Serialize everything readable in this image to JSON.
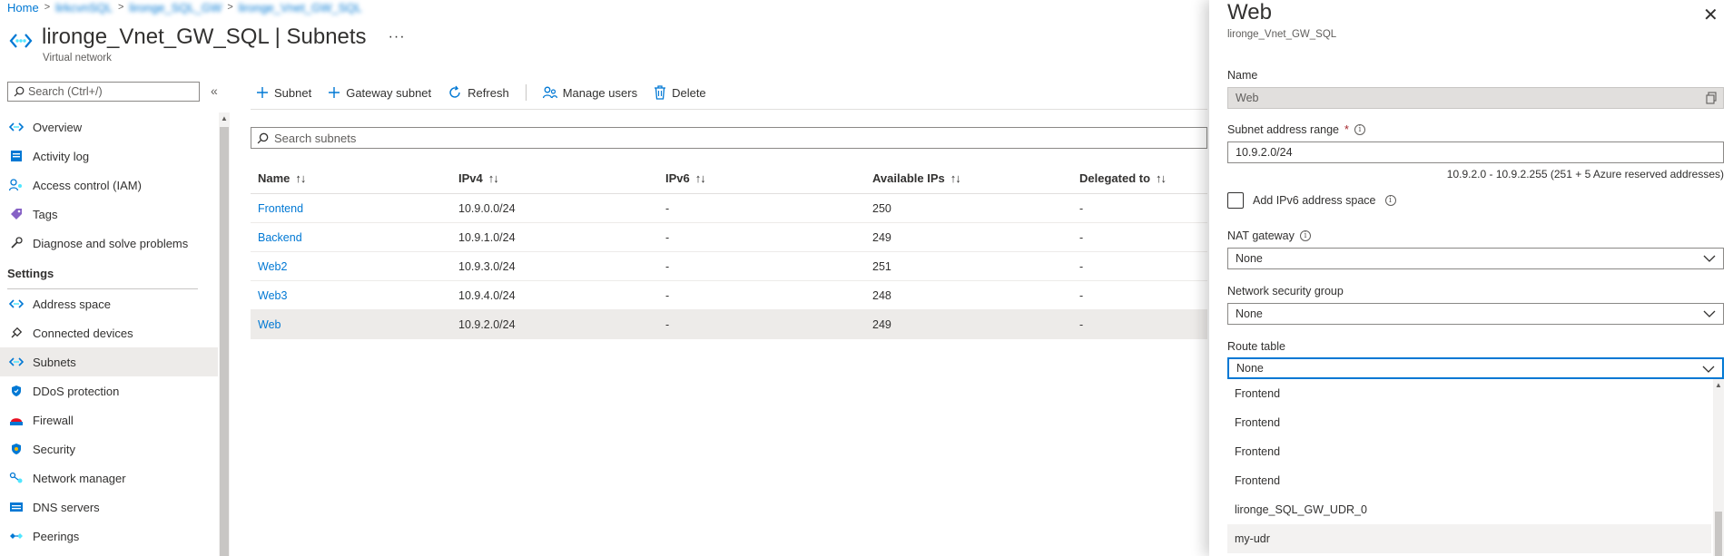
{
  "breadcrumb": {
    "home": "Home",
    "blurred1": "lirkcvnSQL",
    "blurred2": "lironge_SQL_GW",
    "blurred3": "lironge_Vnet_GW_SQL"
  },
  "header": {
    "title": "lironge_Vnet_GW_SQL | Subnets",
    "subtitle": "Virtual network",
    "more": "···"
  },
  "left_nav": {
    "search_placeholder": "Search (Ctrl+/)",
    "collapse": "«",
    "items_top": [
      {
        "label": "Overview",
        "icon": "vnet-icon"
      },
      {
        "label": "Activity log",
        "icon": "activity-log-icon"
      },
      {
        "label": "Access control (IAM)",
        "icon": "iam-icon"
      },
      {
        "label": "Tags",
        "icon": "tag-icon"
      },
      {
        "label": "Diagnose and solve problems",
        "icon": "wrench-icon"
      }
    ],
    "settings_label": "Settings",
    "items_settings": [
      {
        "label": "Address space",
        "icon": "vnet-icon"
      },
      {
        "label": "Connected devices",
        "icon": "plug-icon"
      },
      {
        "label": "Subnets",
        "icon": "vnet-icon",
        "active": true
      },
      {
        "label": "DDoS protection",
        "icon": "shield-icon"
      },
      {
        "label": "Firewall",
        "icon": "firewall-icon"
      },
      {
        "label": "Security",
        "icon": "security-icon"
      },
      {
        "label": "Network manager",
        "icon": "network-manager-icon"
      },
      {
        "label": "DNS servers",
        "icon": "dns-icon"
      },
      {
        "label": "Peerings",
        "icon": "peerings-icon"
      }
    ]
  },
  "toolbar": {
    "subnet": "Subnet",
    "gateway_subnet": "Gateway subnet",
    "refresh": "Refresh",
    "manage_users": "Manage users",
    "delete": "Delete"
  },
  "subnet_search_placeholder": "Search subnets",
  "table": {
    "columns": [
      "Name",
      "IPv4",
      "IPv6",
      "Available IPs",
      "Delegated to"
    ],
    "sort_glyph": "↑↓",
    "rows": [
      {
        "name": "Frontend",
        "ipv4": "10.9.0.0/24",
        "ipv6": "-",
        "available": "250",
        "delegated": "-"
      },
      {
        "name": "Backend",
        "ipv4": "10.9.1.0/24",
        "ipv6": "-",
        "available": "249",
        "delegated": "-"
      },
      {
        "name": "Web2",
        "ipv4": "10.9.3.0/24",
        "ipv6": "-",
        "available": "251",
        "delegated": "-"
      },
      {
        "name": "Web3",
        "ipv4": "10.9.4.0/24",
        "ipv6": "-",
        "available": "248",
        "delegated": "-"
      },
      {
        "name": "Web",
        "ipv4": "10.9.2.0/24",
        "ipv6": "-",
        "available": "249",
        "delegated": "-"
      }
    ]
  },
  "panel": {
    "title": "Web",
    "subtitle": "lironge_Vnet_GW_SQL",
    "close": "✕",
    "name_label": "Name",
    "name_value": "Web",
    "range_label": "Subnet address range",
    "required": "*",
    "range_value": "10.9.2.0/24",
    "range_hint": "10.9.2.0 - 10.9.2.255 (251 + 5 Azure reserved addresses)",
    "ipv6_label": "Add IPv6 address space",
    "nat_label": "NAT gateway",
    "nat_value": "None",
    "nsg_label": "Network security group",
    "nsg_value": "None",
    "route_label": "Route table",
    "route_value": "None",
    "route_options": [
      "Frontend",
      "Frontend",
      "Frontend",
      "Frontend",
      "lironge_SQL_GW_UDR_0",
      "my-udr"
    ]
  }
}
